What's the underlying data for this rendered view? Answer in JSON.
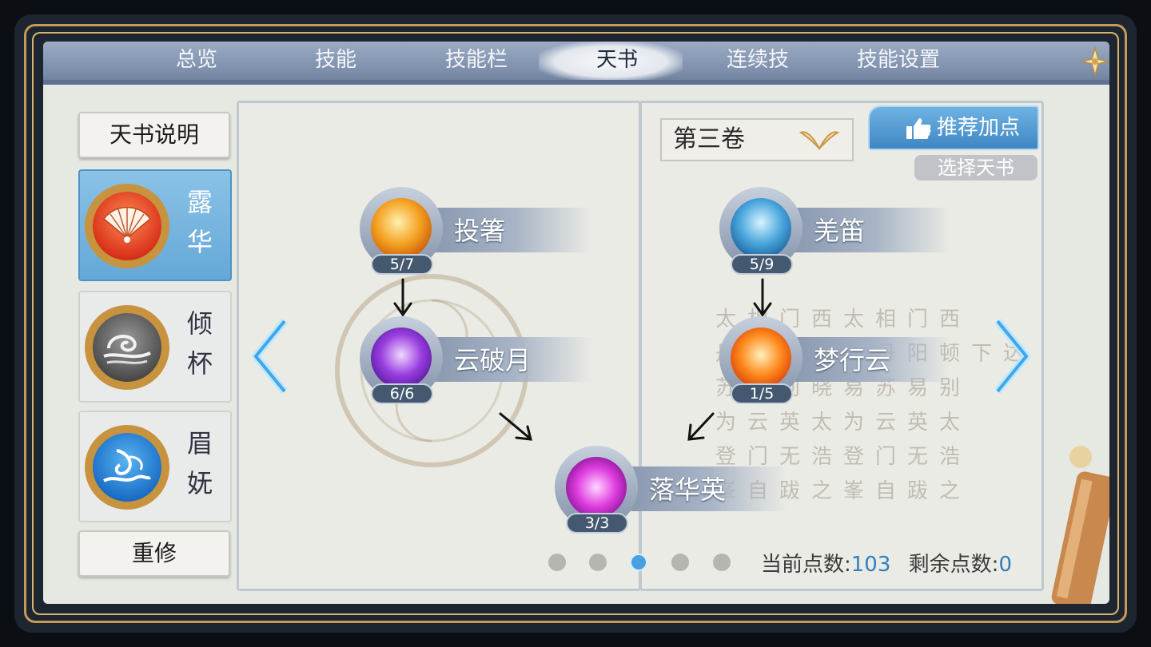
{
  "tabs": [
    "总览",
    "技能",
    "技能栏",
    "天书",
    "连续技",
    "技能设置"
  ],
  "active_tab": "天书",
  "sidebar": {
    "info_button": "天书说明",
    "characters": [
      {
        "name_line1": "露",
        "name_line2": "华",
        "active": true,
        "icon": "folding-fan-icon"
      },
      {
        "name_line1": "倾",
        "name_line2": "杯",
        "active": false,
        "icon": "swirl-cloud-icon"
      },
      {
        "name_line1": "眉",
        "name_line2": "妩",
        "active": false,
        "icon": "phoenix-icon"
      }
    ],
    "reset_button": "重修"
  },
  "left_page": {
    "skills": [
      {
        "name": "投箸",
        "level": "5/7",
        "icon": "flame-blade-icon"
      },
      {
        "name": "云破月",
        "level": "6/6",
        "icon": "purple-feather-icon"
      },
      {
        "name": "落华英",
        "level": "3/3",
        "icon": "magenta-swirl-icon"
      }
    ]
  },
  "right_page": {
    "volume": "第三卷",
    "recommend_button": "推荐加点",
    "select_book_button": "选择天书",
    "skills": [
      {
        "name": "羌笛",
        "level": "5/9",
        "icon": "spirit-figure-icon"
      },
      {
        "name": "梦行云",
        "level": "1/5",
        "icon": "fire-vortex-icon"
      }
    ],
    "background_poem": [
      "太相门西太相门西",
      "丹阳顿下达丹阳顿下达",
      "苏易别晓易苏易别",
      "为云英太为云英太",
      "登门无浩登门无浩",
      "峯自跋之峯自跋之"
    ]
  },
  "pagination": {
    "total": 5,
    "current": 3
  },
  "points": {
    "current_label": "当前点数:",
    "current_value": "103",
    "remaining_label": "剩余点数:",
    "remaining_value": "0"
  },
  "colors": {
    "accent_blue": "#49a0e0",
    "gold_frame": "#c89a55",
    "tab_bar": "#7c8eaa"
  }
}
